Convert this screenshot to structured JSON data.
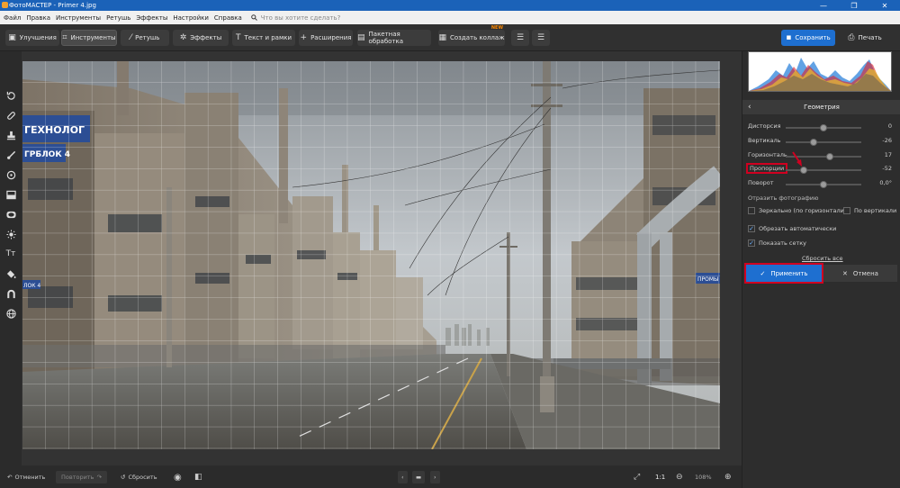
{
  "window": {
    "title": "ФотоМАСТЕР - Primer 4.jpg",
    "min": "—",
    "max": "❐",
    "close": "✕"
  },
  "menu": {
    "items": [
      "Файл",
      "Правка",
      "Инструменты",
      "Ретушь",
      "Эффекты",
      "Настройки",
      "Справка"
    ],
    "search_placeholder": "Что вы хотите сделать?"
  },
  "toolbar": {
    "tabs": [
      {
        "label": "Улучшения",
        "icon": "enhance-icon"
      },
      {
        "label": "Инструменты",
        "icon": "crop-icon",
        "active": true
      },
      {
        "label": "Ретушь",
        "icon": "brush-icon"
      },
      {
        "label": "Эффекты",
        "icon": "sparkle-icon"
      },
      {
        "label": "Текст и рамки",
        "icon": "text-icon"
      },
      {
        "label": "Расширения",
        "icon": "plus-icon"
      }
    ],
    "batch": "Пакетная обработка",
    "collage": "Создать коллаж",
    "collage_badge": "NEW",
    "save": "Сохранить",
    "print": "Печать"
  },
  "panel": {
    "title": "Геометрия",
    "sliders": [
      {
        "label": "Дисторсия",
        "value": "0",
        "level": 0.5
      },
      {
        "label": "Вертикаль",
        "value": "-26",
        "level": 0.37
      },
      {
        "label": "Горизонталь",
        "value": "17",
        "level": 0.58
      },
      {
        "label": "Пропорции",
        "value": "-52",
        "level": 0.24,
        "highlighted": true
      },
      {
        "label": "Поворот",
        "value": "0,0°",
        "level": 0.5
      }
    ],
    "mirror_title": "Отразить фотографию",
    "mirror_h": "Зеркально (по горизонтали)",
    "mirror_v": "По вертикали",
    "auto_crop": "Обрезать автоматически",
    "show_grid": "Показать сетку",
    "reset_all": "Сбросить все",
    "apply": "Применить",
    "cancel": "Отмена"
  },
  "bottom": {
    "undo": "Отменить",
    "redo": "Повторить",
    "reset": "Сбросить",
    "ratio": "1:1",
    "zoom": "108%"
  },
  "colors": {
    "accent": "#1e6fd0",
    "titlebar": "#1b62b8",
    "highlight": "#d00020"
  }
}
